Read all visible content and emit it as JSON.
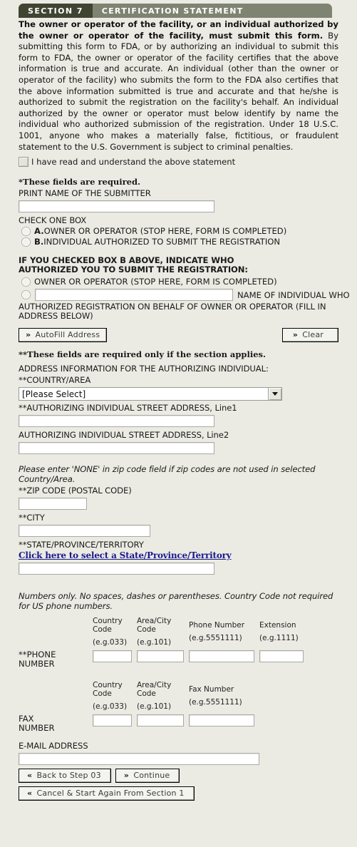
{
  "header": {
    "section_tag": "SECTION 7",
    "section_title": "CERTIFICATION STATEMENT"
  },
  "intro": {
    "bold_lead": "The owner or operator of the facility, or an individual authorized by the owner or operator of the facility, must submit this form.",
    "rest": " By submitting this form to FDA, or by authorizing an individual to submit this form to FDA, the owner or operator of the facility certifies that the above information is true and accurate. An individual (other than the owner or operator of the facility) who submits the form to the FDA also certifies that the above information submitted is true and accurate and that he/she is authorized to submit the registration on the facility's behalf. An individual authorized by the owner or operator must below identify by name the individual who authorized submission of the registration. Under 18 U.S.C. 1001, anyone who makes a materially false, fictitious, or fraudulent statement to the U.S. Government is subject to criminal penalties."
  },
  "acknowledge": {
    "label": "I have read and understand the above statement",
    "checked": false
  },
  "required_note": "*These fields are required.",
  "submitter": {
    "label": "PRINT NAME OF THE SUBMITTER",
    "value": "",
    "check_one_label": "CHECK ONE BOX",
    "options": [
      {
        "prefix": "A.",
        "label": "OWNER OR OPERATOR (STOP HERE, FORM IS COMPLETED)"
      },
      {
        "prefix": "B.",
        "label": "INDIVIDUAL AUTHORIZED TO SUBMIT THE REGISTRATION"
      }
    ]
  },
  "authorizer": {
    "heading_line1": "IF YOU CHECKED BOX B ABOVE, INDICATE WHO",
    "heading_line2": "AUTHORIZED YOU TO SUBMIT THE REGISTRATION:",
    "option_owner": "OWNER OR OPERATOR (STOP HERE, FORM IS COMPLETED)",
    "name_value": "",
    "name_label_inline": "NAME OF INDIVIDUAL WHO",
    "name_label_cont": "AUTHORIZED REGISTRATION ON BEHALF OF OWNER OR OPERATOR (FILL IN ADDRESS BELOW)",
    "autofill_label": "AutoFill Address",
    "clear_label": "Clear"
  },
  "conditional_note": "**These fields are required only if the section applies.",
  "address": {
    "heading": "ADDRESS INFORMATION FOR THE AUTHORIZING INDIVIDUAL:",
    "country_label": "**COUNTRY/AREA",
    "country_value": "[Please Select]",
    "street1_label": "**AUTHORIZING INDIVIDUAL STREET ADDRESS, Line1",
    "street1_value": "",
    "street2_label": "AUTHORIZING INDIVIDUAL STREET ADDRESS, Line2",
    "street2_value": "",
    "zip_hint": "Please enter 'NONE' in zip code field if zip codes are not used in selected Country/Area.",
    "zip_label": "**ZIP CODE (POSTAL CODE)",
    "zip_value": "",
    "city_label": "**CITY",
    "city_value": "",
    "state_label": "**STATE/PROVINCE/TERRITORY",
    "state_link": "Click here to select a State/Province/Territory",
    "state_value": ""
  },
  "phone": {
    "hint": "Numbers only. No spaces, dashes or parentheses. Country Code not required for US phone numbers.",
    "row_label_line1": "**PHONE",
    "row_label_line2": "NUMBER",
    "columns": [
      {
        "head_line1": "Country",
        "head_line2": "Code",
        "example": "(e.g.033)",
        "value": ""
      },
      {
        "head_line1": "Area/City",
        "head_line2": "Code",
        "example": "(e.g.101)",
        "value": ""
      },
      {
        "head_line1": "Phone Number",
        "head_line2": "",
        "example": "(e.g.5551111)",
        "value": ""
      },
      {
        "head_line1": "Extension",
        "head_line2": "",
        "example": "(e.g.1111)",
        "value": ""
      }
    ]
  },
  "fax": {
    "row_label_line1": "FAX",
    "row_label_line2": "NUMBER",
    "columns": [
      {
        "head_line1": "Country",
        "head_line2": "Code",
        "example": "(e.g.033)",
        "value": ""
      },
      {
        "head_line1": "Area/City",
        "head_line2": "Code",
        "example": "(e.g.101)",
        "value": ""
      },
      {
        "head_line1": "Fax Number",
        "head_line2": "",
        "example": "(e.g.5551111)",
        "value": ""
      }
    ]
  },
  "email": {
    "label": "E-MAIL ADDRESS",
    "value": ""
  },
  "footer": {
    "back_label": "Back to Step 03",
    "continue_label": "Continue",
    "cancel_label": "Cancel & Start Again From Section 1"
  },
  "colors": {
    "page_bg": "#ebebe4",
    "section_tag_bg": "#3f4530",
    "section_bar_bg": "#7f8472",
    "link": "#1a1a8c"
  }
}
